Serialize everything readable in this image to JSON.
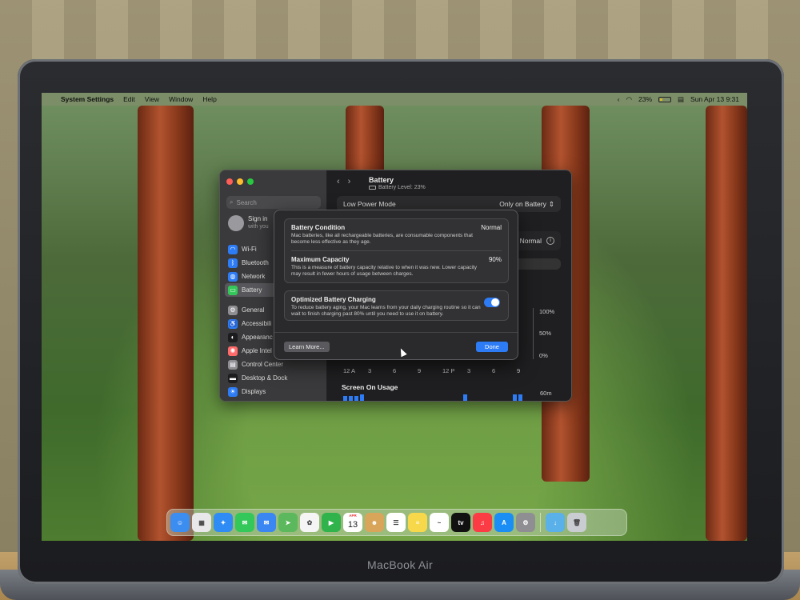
{
  "device": {
    "brand_label": "MacBook Air"
  },
  "menubar": {
    "app_name": "System Settings",
    "menus": [
      "Edit",
      "View",
      "Window",
      "Help"
    ],
    "battery_percent": "23%",
    "datetime": "Sun Apr 13  9:31"
  },
  "window": {
    "search_placeholder": "Search",
    "account": {
      "title": "Sign in",
      "subtitle": "with you"
    },
    "sidebar": [
      {
        "label": "Wi-Fi",
        "icon": "wifi-icon",
        "color": "#2d7cf6"
      },
      {
        "label": "Bluetooth",
        "icon": "bluetooth-icon",
        "color": "#2d7cf6"
      },
      {
        "label": "Network",
        "icon": "globe-icon",
        "color": "#2d7cf6"
      },
      {
        "label": "Battery",
        "icon": "battery-icon",
        "color": "#34c759"
      },
      {
        "label": "General",
        "icon": "gear-icon",
        "color": "#8e8e93"
      },
      {
        "label": "Accessibili",
        "icon": "accessibility-icon",
        "color": "#2d7cf6"
      },
      {
        "label": "Appearanc",
        "icon": "appearance-icon",
        "color": "#1c1c1e"
      },
      {
        "label": "Apple Intel",
        "icon": "apple-intelligence-icon",
        "color": "#ff6b6b"
      },
      {
        "label": "Control Center",
        "icon": "control-center-icon",
        "color": "#8e8e93"
      },
      {
        "label": "Desktop & Dock",
        "icon": "dock-icon",
        "color": "#1c1c1e"
      },
      {
        "label": "Displays",
        "icon": "display-icon",
        "color": "#2d7cf6"
      }
    ],
    "content": {
      "title": "Battery",
      "subtitle": "Battery Level: 23%",
      "low_power_label": "Low Power Mode",
      "low_power_value": "Only on Battery",
      "health_value": "Normal",
      "health_info_glyph": "i",
      "tab_fragment": "s",
      "y_labels": [
        "100%",
        "50%",
        "0%"
      ],
      "x_labels": [
        "12 A",
        "3",
        "6",
        "9",
        "12 P",
        "3",
        "6",
        "9"
      ],
      "usage_title": "Screen On Usage",
      "usage_max": "60m"
    }
  },
  "sheet": {
    "battery_condition": {
      "title": "Battery Condition",
      "value": "Normal",
      "description": "Mac batteries, like all rechargeable batteries, are consumable components that become less effective as they age."
    },
    "maximum_capacity": {
      "title": "Maximum Capacity",
      "value": "90%",
      "description": "This is a measure of battery capacity relative to when it was new. Lower capacity may result in fewer hours of usage between charges."
    },
    "optimized_charging": {
      "title": "Optimized Battery Charging",
      "enabled": true,
      "description": "To reduce battery aging, your Mac learns from your daily charging routine so it can wait to finish charging past 80% until you need to use it on battery."
    },
    "learn_more_label": "Learn More...",
    "done_label": "Done"
  },
  "dock": {
    "apps": [
      {
        "name": "finder-icon",
        "color": "#3b8df0",
        "glyph": "☺"
      },
      {
        "name": "launchpad-icon",
        "color": "#e8e8ea",
        "glyph": "▦"
      },
      {
        "name": "safari-icon",
        "color": "#2f8cf5",
        "glyph": "✦"
      },
      {
        "name": "messages-icon",
        "color": "#34c759",
        "glyph": "✉"
      },
      {
        "name": "mail-icon",
        "color": "#3a86f3",
        "glyph": "✉"
      },
      {
        "name": "maps-icon",
        "color": "#5cb85c",
        "glyph": "➤"
      },
      {
        "name": "photos-icon",
        "color": "#f5f5f5",
        "glyph": "✿"
      },
      {
        "name": "facetime-icon",
        "color": "#2fb34a",
        "glyph": "▶"
      },
      {
        "name": "calendar-icon",
        "color": "#ffffff",
        "glyph": ""
      },
      {
        "name": "contacts-icon",
        "color": "#d9a55a",
        "glyph": "☻"
      },
      {
        "name": "reminders-icon",
        "color": "#ffffff",
        "glyph": "☰"
      },
      {
        "name": "notes-icon",
        "color": "#f7d84a",
        "glyph": "≡"
      },
      {
        "name": "freeform-icon",
        "color": "#ffffff",
        "glyph": "~"
      },
      {
        "name": "apple-tv-icon",
        "color": "#111111",
        "glyph": "tv"
      },
      {
        "name": "music-icon",
        "color": "#fc3c44",
        "glyph": "♫"
      },
      {
        "name": "app-store-icon",
        "color": "#1a8ef5",
        "glyph": "A"
      },
      {
        "name": "system-settings-icon",
        "color": "#8e8e93",
        "glyph": "⚙"
      }
    ],
    "calendar": {
      "month": "APR",
      "day": "13"
    },
    "extras": [
      {
        "name": "downloads-folder-icon",
        "color": "#5ab0e8",
        "glyph": "↓"
      },
      {
        "name": "trash-icon",
        "color": "#c9ccd1",
        "glyph": "🗑"
      }
    ]
  }
}
